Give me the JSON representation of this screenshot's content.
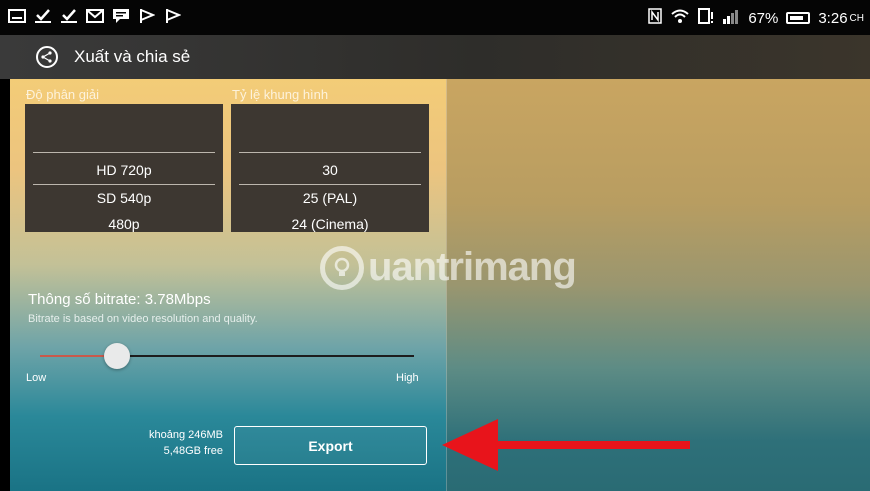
{
  "status_bar": {
    "notification_icons": [
      "keyboard-icon",
      "download-complete-icon",
      "download-complete-icon",
      "gmail-icon",
      "chat-icon",
      "flag-icon",
      "flag-icon"
    ],
    "system_icons": [
      "nfc-icon",
      "wifi-icon",
      "sim-icon",
      "signal-icon"
    ],
    "battery": "67%",
    "time": "3:26",
    "time_suffix": "CH"
  },
  "app_bar": {
    "title": "Xuất và chia sẻ"
  },
  "resolution": {
    "label": "Độ phân giải",
    "options": [
      "HD 720p",
      "SD 540p",
      "480p"
    ],
    "selected": "HD 720p"
  },
  "frame_rate": {
    "label": "Tỷ lệ khung hình",
    "options": [
      "30",
      "25 (PAL)",
      "24 (Cinema)"
    ],
    "selected": "30"
  },
  "bitrate": {
    "title": "Thông số bitrate: 3.78Mbps",
    "description": "Bitrate is based on video resolution and quality.",
    "low_label": "Low",
    "high_label": "High",
    "level": 0.2
  },
  "export": {
    "size_estimate": "khoảng 246MB",
    "free_space": "5,48GB free",
    "button_label": "Export"
  },
  "watermark": {
    "text": "uantrimang"
  },
  "colors": {
    "arrow": "#e8141b",
    "slider_active": "#c9594b"
  }
}
